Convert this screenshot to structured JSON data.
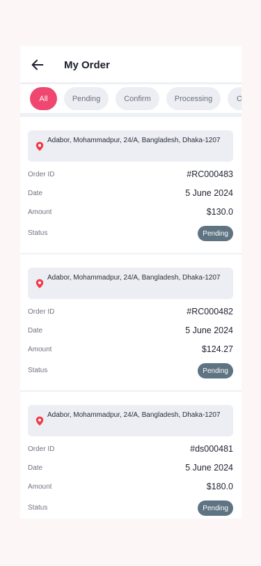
{
  "header": {
    "title": "My Order"
  },
  "tabs": [
    {
      "label": "All"
    },
    {
      "label": "Pending"
    },
    {
      "label": "Confirm"
    },
    {
      "label": "Processing"
    },
    {
      "label": "O"
    }
  ],
  "colors": {
    "accent": "#ef476f",
    "badge": "#5f7482",
    "pin": "#ef3b4a"
  },
  "orders": [
    {
      "address": "Adabor, Mohammadpur, 24/A, Bangladesh, Dhaka-1207",
      "order_id_label": "Order ID",
      "order_id": "#RC000483",
      "date_label": "Date",
      "date": "5 June 2024",
      "amount_label": "Amount",
      "amount": "$130.0",
      "status_label": "Status",
      "status": "Pending"
    },
    {
      "address": "Adabor, Mohammadpur, 24/A, Bangladesh, Dhaka-1207",
      "order_id_label": "Order ID",
      "order_id": "#RC000482",
      "date_label": "Date",
      "date": "5 June 2024",
      "amount_label": "Amount",
      "amount": "$124.27",
      "status_label": "Status",
      "status": "Pending"
    },
    {
      "address": "Adabor, Mohammadpur, 24/A, Bangladesh, Dhaka-1207",
      "order_id_label": "Order ID",
      "order_id": "#ds000481",
      "date_label": "Date",
      "date": "5 June 2024",
      "amount_label": "Amount",
      "amount": "$180.0",
      "status_label": "Status",
      "status": "Pending"
    }
  ]
}
